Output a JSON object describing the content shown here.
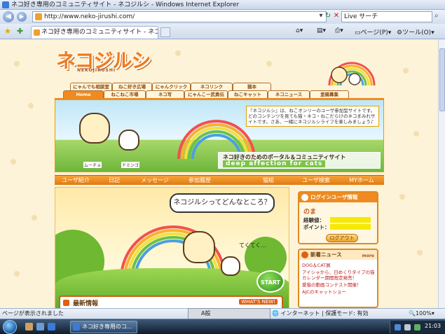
{
  "window": {
    "title": "ネコ好き専用のコミュニティサイト - ネコジルシ - Windows Internet Explorer"
  },
  "address_bar": {
    "url": "http://www.neko-jirushi.com/",
    "search_placeholder": "Live サーチ"
  },
  "tabs": [
    {
      "label": "ネコ好き専用のコミュニティサイト - ネコジルシ"
    }
  ],
  "toolbar": {
    "page_label": "ページ(P)",
    "tools_label": "ツール(O)"
  },
  "site": {
    "logo_text": "ネコジルシ",
    "logo_sub": "NEKOJIRUSHI",
    "nav_row1": [
      "にゃんでも相談室",
      "ねこ好き広場",
      "にゃんクリック",
      "ネコリンク",
      "猫本"
    ],
    "nav_row2": [
      "Home",
      "ねこねこ市場",
      "ネコ写",
      "にゃんこー武勇伝",
      "ねこキャット",
      "ネコニュース",
      "里親募集"
    ],
    "banner": {
      "message": "『ネコジルシ』は、ねこオンリーのユーザ参加型サイトです。どのコンテンツを見ても猫・ネコ・ねこだらけのネコまみれサイトです。さあ、一緒にネコジルシライフを楽しみましょう♪",
      "title": "ネコ好きのためのポータル＆コミュニティサイト",
      "tagline": "deep affection for cats",
      "cat1": "ムーチョ",
      "cat2": "ドミンゴ"
    },
    "menu": [
      "ユーザ紹介",
      "日記",
      "メッセージ",
      "参加履歴",
      "猫組",
      "ユーザ検索",
      "MYホーム"
    ],
    "hero": {
      "bubble": "ネコジルシってどんなところ？",
      "walking": "てくてく…",
      "start": "START"
    },
    "news": {
      "header": "最新情報",
      "whats_new": "WHAT'S NEW!"
    },
    "login": {
      "header": "ログインユーザ情報",
      "user": "のま",
      "exp_label": "経験値：",
      "point_label": "ポイント：",
      "logout": "ログアウト"
    },
    "new_arrivals": {
      "header": "新着ニュース",
      "more": "more",
      "items": [
        "DOG＆CAT展",
        "アイシャから、日めくりタイプの猫カレンダー期間限定発売！",
        "愛猫の動画コンテスト開催！",
        "AJCのキャットショー"
      ]
    }
  },
  "status_bar": {
    "text": "ページが表示されました",
    "zone": "インターネット | 保護モード: 有効",
    "zoom": "100%",
    "ime": "A般"
  },
  "taskbar": {
    "task_label": "ネコ好き専用のコ...",
    "clock": "21:03"
  },
  "colors": {
    "brand_orange": "#f08a20",
    "page_bg": "#fdf3d8"
  }
}
